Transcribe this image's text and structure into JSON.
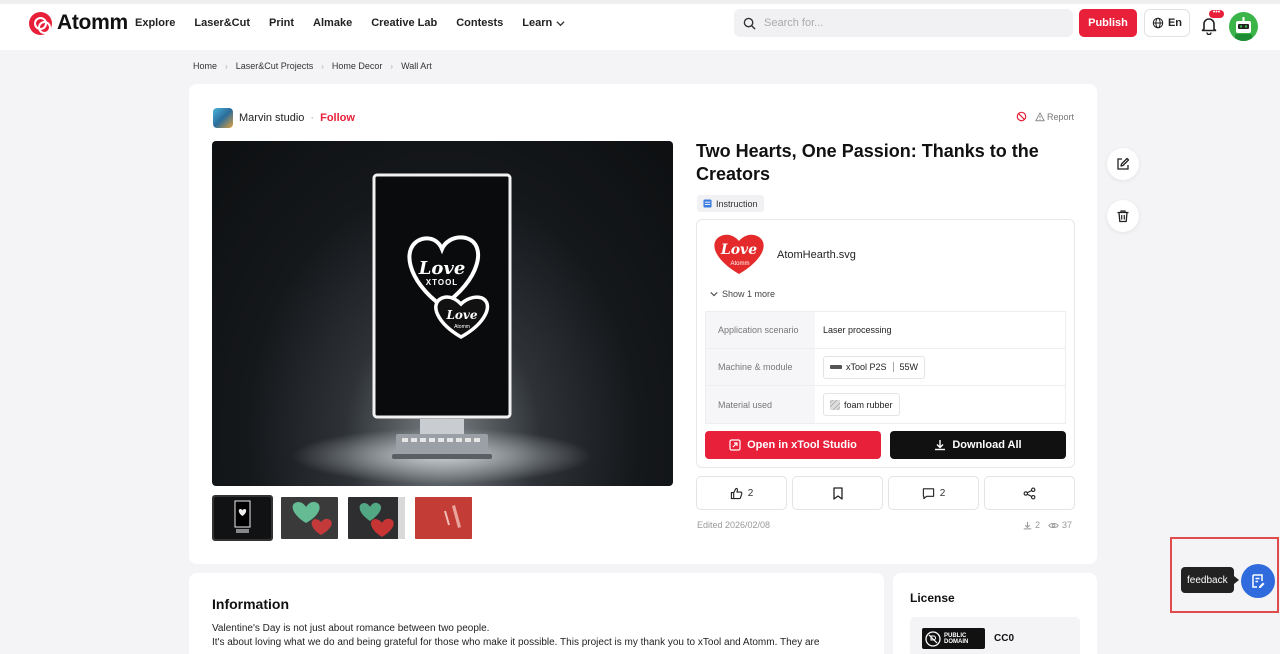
{
  "header": {
    "brand": "Atomm",
    "nav": [
      "Explore",
      "Laser&Cut",
      "Print",
      "Almake",
      "Creative Lab",
      "Contests",
      "Learn"
    ],
    "search_placeholder": "Search for...",
    "publish_label": "Publish",
    "language": "En",
    "notification_badge": "•••",
    "accent_color": "#e8203a"
  },
  "breadcrumb": [
    "Home",
    "Laser&Cut Projects",
    "Home Decor",
    "Wall Art"
  ],
  "author": {
    "name": "Marvin studio",
    "separator": "·",
    "follow_label": "Follow",
    "report_label": "Report"
  },
  "project": {
    "title": "Two Hearts, One Passion: Thanks to the Creators",
    "tag": "Instruction",
    "file_name": "AtomHearth.svg",
    "show_more": "Show 1 more",
    "specs": [
      {
        "label": "Application scenario",
        "value": "Laser processing"
      },
      {
        "label": "Machine & module",
        "value": "xTool P2S",
        "value2": "55W"
      },
      {
        "label": "Material used",
        "value": "foam rubber"
      }
    ],
    "open_label": "Open in xTool Studio",
    "download_label": "Download All",
    "likes": "2",
    "comments": "2",
    "edited": "Edited 2026/02/08",
    "downloads": "2",
    "views": "37",
    "hero_text_1": "Love",
    "hero_text_2": "XTOOL",
    "hero_text_3": "Love",
    "hero_text_4": "Atomm",
    "file_thumb_text_1": "Love",
    "file_thumb_text_2": "Atomm"
  },
  "information": {
    "title": "Information",
    "line1": "Valentine's Day is not just about romance between two people.",
    "line2": "It's about loving what we do and being grateful for those who make it possible. This project is my thank you to xTool and Atomm. They are"
  },
  "license": {
    "title": "License",
    "badge": "PUBLIC DOMAIN",
    "name": "CC0"
  },
  "feedback": {
    "label": "feedback"
  }
}
